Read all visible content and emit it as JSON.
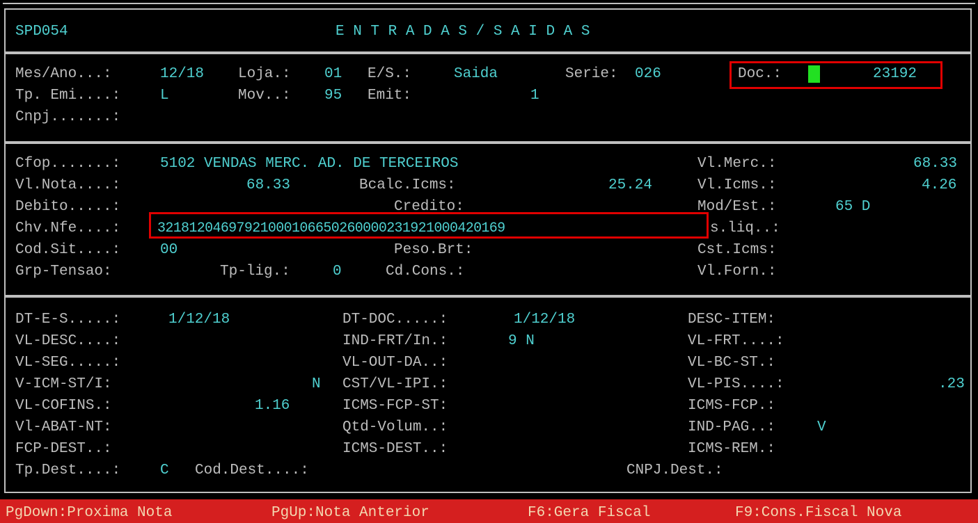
{
  "header": {
    "program_id": "SPD054",
    "title": "E N T R A D A S / S A I D A S"
  },
  "section1": {
    "mes_ano_label": "Mes/Ano...:",
    "mes_ano_value": "12/18",
    "loja_label": "Loja.:",
    "loja_value": "01",
    "es_label": "E/S.:",
    "es_value": "Saida",
    "serie_label": "Serie:",
    "serie_value": "026",
    "doc_label": "Doc.:",
    "doc_value": "23192",
    "tp_emi_label": "Tp. Emi....:",
    "tp_emi_value": "L",
    "mov_label": "Mov..:",
    "mov_value": "95",
    "emit_label": "Emit:",
    "emit_value": "1",
    "cnpj_label": "Cnpj.......:"
  },
  "section2": {
    "cfop_label": "Cfop.......:",
    "cfop_value": "5102 VENDAS MERC. AD. DE TERCEIROS",
    "vl_merc_label": "Vl.Merc.:",
    "vl_merc_value": "68.33",
    "vl_nota_label": "Vl.Nota....:",
    "vl_nota_value": "68.33",
    "bcalc_icms_label": "Bcalc.Icms:",
    "bcalc_icms_value": "25.24",
    "vl_icms_label": "Vl.Icms.:",
    "vl_icms_value": "4.26",
    "debito_label": "Debito.....:",
    "credito_label": "Credito:",
    "mod_est_label": "Mod/Est.:",
    "mod_est_value": "65 D",
    "chv_nfe_label": "Chv.Nfe....:",
    "chv_nfe_value": "32181204697921000106650260000231921000420169",
    "ps_liq_label": "s.liq..:",
    "cod_sit_label": "Cod.Sit....:",
    "cod_sit_value": "00",
    "peso_brt_label": "Peso.Brt:",
    "cst_icms_label": "Cst.Icms:",
    "grp_tensao_label": "Grp-Tensao:",
    "tp_lig_label": "Tp-lig.:",
    "tp_lig_value": "0",
    "cd_cons_label": "Cd.Cons.:",
    "vl_forn_label": "Vl.Forn.:"
  },
  "section3": {
    "dt_es_label": "DT-E-S.....:",
    "dt_es_value": "1/12/18",
    "dt_doc_label": "DT-DOC.....:",
    "dt_doc_value": "1/12/18",
    "desc_item_label": "DESC-ITEM:",
    "vl_desc_label": "VL-DESC....:",
    "ind_frt_label": "IND-FRT/In.:",
    "ind_frt_value": "9 N",
    "vl_frt_label": "VL-FRT....:",
    "vl_seg_label": "VL-SEG.....:",
    "vl_out_da_label": "VL-OUT-DA..:",
    "vl_bc_st_label": "VL-BC-ST.:",
    "v_icm_st_label": "V-ICM-ST/I:",
    "v_icm_st_value": "N",
    "cst_vl_ipi_label": "CST/VL-IPI.:",
    "vl_pis_label": "VL-PIS....:",
    "vl_pis_value": ".23",
    "vl_cofins_label": "VL-COFINS.:",
    "vl_cofins_value": "1.16",
    "icms_fcp_st_label": "ICMS-FCP-ST:",
    "icms_fcp_label": "ICMS-FCP.:",
    "vl_abat_nt_label": "Vl-ABAT-NT:",
    "qtd_volum_label": "Qtd-Volum..:",
    "ind_pag_label": "IND-PAG..:",
    "ind_pag_value": "V",
    "fcp_dest_label": "FCP-DEST..:",
    "icms_dest_label": "ICMS-DEST..:",
    "icms_rem_label": "ICMS-REM.:",
    "tp_dest_label": "Tp.Dest....:",
    "tp_dest_value": "C",
    "cod_dest_label": "Cod.Dest....:",
    "cnpj_dest_label": "CNPJ.Dest.:"
  },
  "statusbar": {
    "key_pgdown": "PgDown:Proxima Nota",
    "key_pgup": "PgUp:Nota Anterior",
    "key_f6": "F6:Gera Fiscal",
    "key_f9": "F9:Cons.Fiscal Nova"
  },
  "colors": {
    "background": "#000000",
    "label": "#bdbdbd",
    "value": "#4fd0d0",
    "highlight_border": "#e00000",
    "cursor": "#22e022",
    "statusbar_bg": "#d51f1f",
    "statusbar_text": "#f3d7b0"
  }
}
